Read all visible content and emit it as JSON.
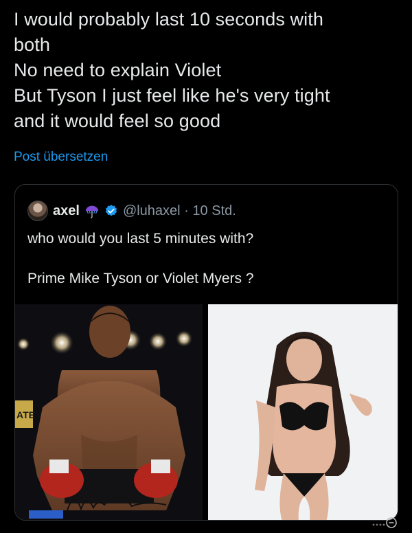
{
  "post": {
    "lines": [
      "I would probably last 10 seconds with",
      "both",
      "No need to explain Violet",
      "But Tyson I just feel like he's very tight",
      "and it would feel so good"
    ],
    "translate_label": "Post übersetzen"
  },
  "quote": {
    "author_name": "axel",
    "handle": "@luhaxel",
    "separator": "·",
    "time": "10 Std.",
    "text_lines": [
      "who would you last 5 minutes with?",
      "Prime Mike Tyson or Violet Myers ?"
    ],
    "images": {
      "left": {
        "icon": "photo-boxer",
        "sign_text": "ATE"
      },
      "right": {
        "icon": "photo-woman"
      }
    }
  },
  "colors": {
    "background": "#000000",
    "text": "#e7e9ea",
    "link": "#1d9bf0",
    "muted": "#8b98a5",
    "border": "#2f3336",
    "verified": "#1d9bf0"
  }
}
